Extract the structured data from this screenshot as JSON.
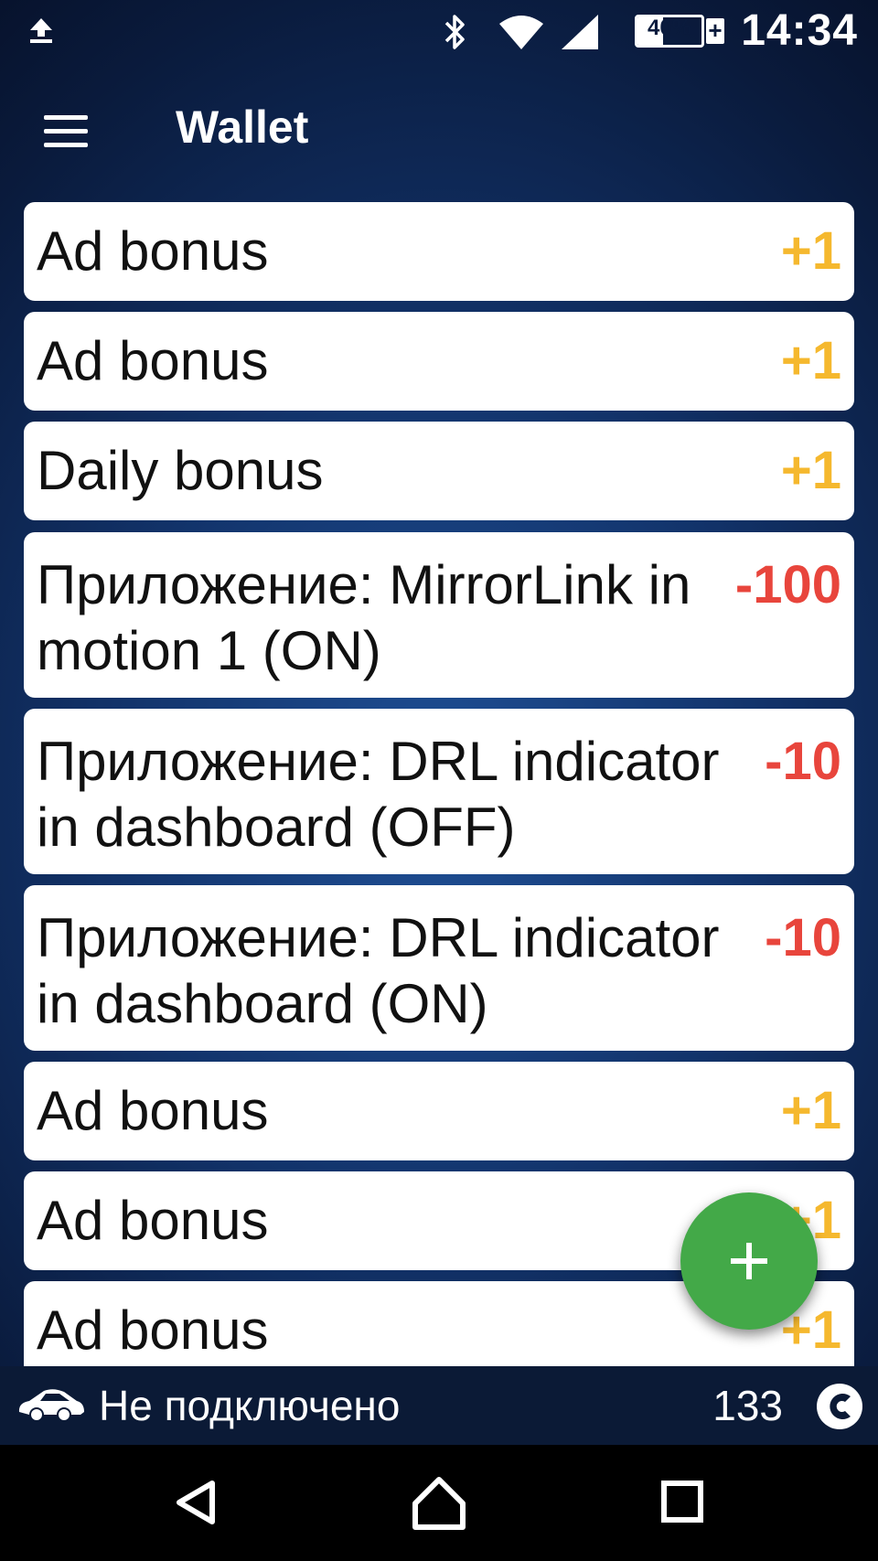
{
  "status_bar": {
    "upload_icon": "upload-icon",
    "bluetooth_icon": "bluetooth-icon",
    "wifi_icon": "wifi-icon",
    "signal_icon": "signal-icon",
    "battery_percent": "40%",
    "battery_level": 0.4,
    "battery_plus": "+",
    "time": "14:34"
  },
  "app_bar": {
    "title": "Wallet",
    "menu_icon": "hamburger-menu-icon"
  },
  "transactions": [
    {
      "label": "Ad bonus",
      "amount": "+1",
      "type": "credit"
    },
    {
      "label": "Ad bonus",
      "amount": "+1",
      "type": "credit"
    },
    {
      "label": "Daily bonus",
      "amount": "+1",
      "type": "credit"
    },
    {
      "label_line1": "Приложение: MirrorLink in",
      "label_line2": "motion 1 (ON)",
      "amount": "-100",
      "type": "debit"
    },
    {
      "label_line1": "Приложение: DRL indicator",
      "label_line2": "in dashboard (OFF)",
      "amount": "-10",
      "type": "debit"
    },
    {
      "label_line1": "Приложение: DRL indicator",
      "label_line2": "in dashboard (ON)",
      "amount": "-10",
      "type": "debit"
    },
    {
      "label": "Ad bonus",
      "amount": "+1",
      "type": "credit"
    },
    {
      "label": "Ad bonus",
      "amount": "+1",
      "type": "credit"
    },
    {
      "label": "Ad bonus",
      "amount": "+1",
      "type": "credit"
    }
  ],
  "colors": {
    "credit": "#f5b82e",
    "debit": "#e8453c",
    "fab": "#43a948"
  },
  "fab": {
    "label": "+",
    "icon": "plus-icon"
  },
  "bottom_status": {
    "car_icon": "car-icon",
    "connection_text": "Не подключено",
    "coins": "133",
    "coin_icon": "coin-icon"
  },
  "nav_bar": {
    "back_icon": "back-triangle-icon",
    "home_icon": "home-icon",
    "recents_icon": "recents-square-icon"
  }
}
